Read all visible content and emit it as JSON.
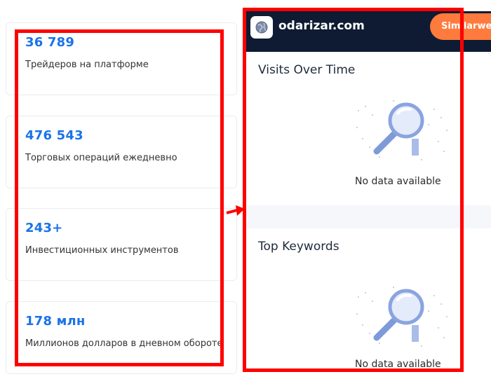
{
  "stats": [
    {
      "value": "36 789",
      "label": "Трейдеров на платформе"
    },
    {
      "value": "476 543",
      "label": "Торговых операций ежедневно"
    },
    {
      "value": "243+",
      "label": "Инвестиционных инструментов"
    },
    {
      "value": "178 млн",
      "label": "Миллионов долларов в дневном обороте"
    }
  ],
  "widget": {
    "site_name": "odarizar.com",
    "brand_button_label": "Similarweb",
    "site_icon": "globe-icon",
    "visits": {
      "title": "Visits Over Time",
      "empty_text": "No data available",
      "icon": "magnifier-icon"
    },
    "keywords": {
      "title": "Top Keywords",
      "empty_text": "No data available",
      "icon": "magnifier-icon"
    }
  },
  "colors": {
    "stat_value": "#1a73e8",
    "highlight": "#ff0000",
    "widget_header": "#0e1b33",
    "brand_button": "#ff7a3d"
  }
}
